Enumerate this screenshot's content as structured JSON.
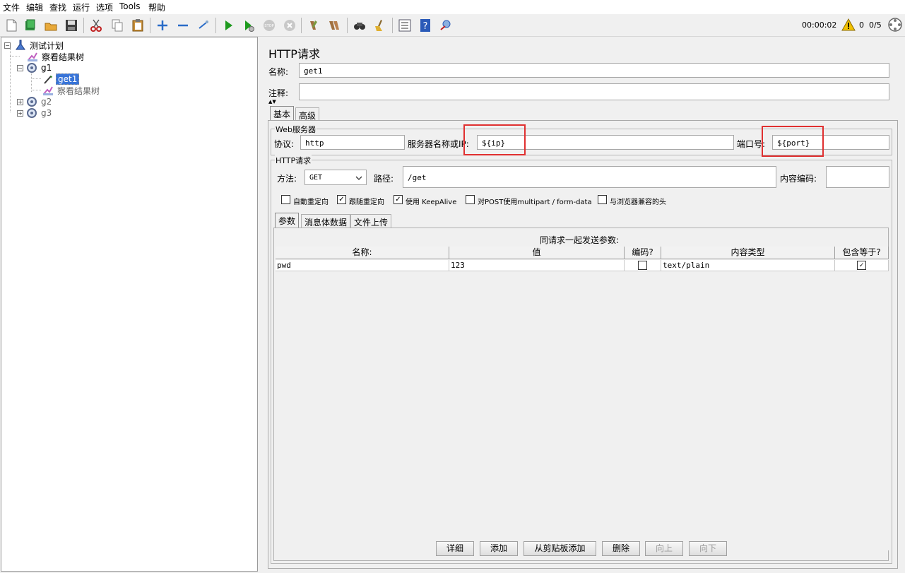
{
  "menu": [
    "文件",
    "编辑",
    "查找",
    "运行",
    "选项",
    "Tools",
    "帮助"
  ],
  "toolbar": {
    "elapsed": "00:00:02",
    "warnings": "0",
    "threads": "0/5"
  },
  "tree": {
    "plan": "测试计划",
    "listener1": "察看结果树",
    "g1": "g1",
    "get1": "get1",
    "listener2": "察看结果树",
    "g2": "g2",
    "g3": "g3"
  },
  "sampler": {
    "title": "HTTP请求",
    "name_label": "名称:",
    "name_value": "get1",
    "comment_label": "注释:",
    "comment_value": "",
    "tabs": [
      "基本",
      "高级"
    ],
    "web_server": {
      "title": "Web服务器",
      "protocol_label": "协议:",
      "protocol_value": "http",
      "server_label": "服务器名称或IP:",
      "server_value": "${ip}",
      "port_label": "端口号:",
      "port_value": "${port}"
    },
    "http_request": {
      "title": "HTTP请求",
      "method_label": "方法:",
      "method_value": "GET",
      "path_label": "路径:",
      "path_value": "/get",
      "encoding_label": "内容编码:",
      "encoding_value": ""
    },
    "options": [
      {
        "label": "自動重定向",
        "checked": false
      },
      {
        "label": "跟随重定向",
        "checked": true
      },
      {
        "label": "使用 KeepAlive",
        "checked": true
      },
      {
        "label": "对POST使用multipart / form-data",
        "checked": false
      },
      {
        "label": "与浏览器兼容的头",
        "checked": false
      }
    ],
    "subtabs": [
      "参数",
      "消息体数据",
      "文件上传"
    ],
    "params_caption": "同请求一起发送参数:",
    "columns": [
      "名称:",
      "值",
      "编码?",
      "内容类型",
      "包含等于?"
    ],
    "rows": [
      {
        "name": "pwd",
        "value": "123",
        "encode": false,
        "content_type": "text/plain",
        "include_equals": true
      }
    ],
    "buttons": [
      {
        "label": "详细",
        "enabled": true
      },
      {
        "label": "添加",
        "enabled": true
      },
      {
        "label": "从剪贴板添加",
        "enabled": true
      },
      {
        "label": "删除",
        "enabled": true
      },
      {
        "label": "向上",
        "enabled": false
      },
      {
        "label": "向下",
        "enabled": false
      }
    ]
  },
  "colors": {
    "selection": "#3874d8",
    "highlight_box": "#e03030",
    "run_green": "#1e9a1e"
  }
}
